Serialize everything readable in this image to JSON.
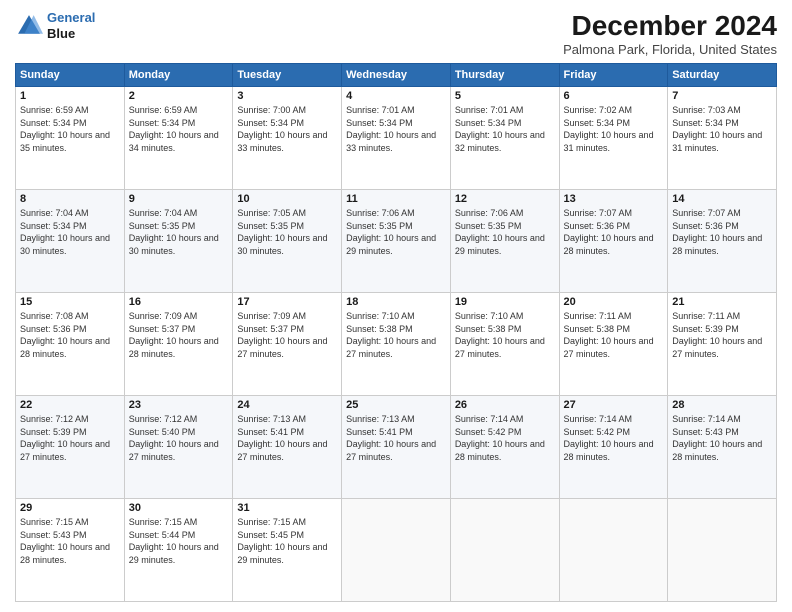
{
  "header": {
    "logo_line1": "General",
    "logo_line2": "Blue",
    "title": "December 2024",
    "subtitle": "Palmona Park, Florida, United States"
  },
  "calendar": {
    "weekdays": [
      "Sunday",
      "Monday",
      "Tuesday",
      "Wednesday",
      "Thursday",
      "Friday",
      "Saturday"
    ],
    "weeks": [
      [
        {
          "day": "1",
          "sunrise": "6:59 AM",
          "sunset": "5:34 PM",
          "daylight": "10 hours and 35 minutes."
        },
        {
          "day": "2",
          "sunrise": "6:59 AM",
          "sunset": "5:34 PM",
          "daylight": "10 hours and 34 minutes."
        },
        {
          "day": "3",
          "sunrise": "7:00 AM",
          "sunset": "5:34 PM",
          "daylight": "10 hours and 33 minutes."
        },
        {
          "day": "4",
          "sunrise": "7:01 AM",
          "sunset": "5:34 PM",
          "daylight": "10 hours and 33 minutes."
        },
        {
          "day": "5",
          "sunrise": "7:01 AM",
          "sunset": "5:34 PM",
          "daylight": "10 hours and 32 minutes."
        },
        {
          "day": "6",
          "sunrise": "7:02 AM",
          "sunset": "5:34 PM",
          "daylight": "10 hours and 31 minutes."
        },
        {
          "day": "7",
          "sunrise": "7:03 AM",
          "sunset": "5:34 PM",
          "daylight": "10 hours and 31 minutes."
        }
      ],
      [
        {
          "day": "8",
          "sunrise": "7:04 AM",
          "sunset": "5:34 PM",
          "daylight": "10 hours and 30 minutes."
        },
        {
          "day": "9",
          "sunrise": "7:04 AM",
          "sunset": "5:35 PM",
          "daylight": "10 hours and 30 minutes."
        },
        {
          "day": "10",
          "sunrise": "7:05 AM",
          "sunset": "5:35 PM",
          "daylight": "10 hours and 30 minutes."
        },
        {
          "day": "11",
          "sunrise": "7:06 AM",
          "sunset": "5:35 PM",
          "daylight": "10 hours and 29 minutes."
        },
        {
          "day": "12",
          "sunrise": "7:06 AM",
          "sunset": "5:35 PM",
          "daylight": "10 hours and 29 minutes."
        },
        {
          "day": "13",
          "sunrise": "7:07 AM",
          "sunset": "5:36 PM",
          "daylight": "10 hours and 28 minutes."
        },
        {
          "day": "14",
          "sunrise": "7:07 AM",
          "sunset": "5:36 PM",
          "daylight": "10 hours and 28 minutes."
        }
      ],
      [
        {
          "day": "15",
          "sunrise": "7:08 AM",
          "sunset": "5:36 PM",
          "daylight": "10 hours and 28 minutes."
        },
        {
          "day": "16",
          "sunrise": "7:09 AM",
          "sunset": "5:37 PM",
          "daylight": "10 hours and 28 minutes."
        },
        {
          "day": "17",
          "sunrise": "7:09 AM",
          "sunset": "5:37 PM",
          "daylight": "10 hours and 27 minutes."
        },
        {
          "day": "18",
          "sunrise": "7:10 AM",
          "sunset": "5:38 PM",
          "daylight": "10 hours and 27 minutes."
        },
        {
          "day": "19",
          "sunrise": "7:10 AM",
          "sunset": "5:38 PM",
          "daylight": "10 hours and 27 minutes."
        },
        {
          "day": "20",
          "sunrise": "7:11 AM",
          "sunset": "5:38 PM",
          "daylight": "10 hours and 27 minutes."
        },
        {
          "day": "21",
          "sunrise": "7:11 AM",
          "sunset": "5:39 PM",
          "daylight": "10 hours and 27 minutes."
        }
      ],
      [
        {
          "day": "22",
          "sunrise": "7:12 AM",
          "sunset": "5:39 PM",
          "daylight": "10 hours and 27 minutes."
        },
        {
          "day": "23",
          "sunrise": "7:12 AM",
          "sunset": "5:40 PM",
          "daylight": "10 hours and 27 minutes."
        },
        {
          "day": "24",
          "sunrise": "7:13 AM",
          "sunset": "5:41 PM",
          "daylight": "10 hours and 27 minutes."
        },
        {
          "day": "25",
          "sunrise": "7:13 AM",
          "sunset": "5:41 PM",
          "daylight": "10 hours and 27 minutes."
        },
        {
          "day": "26",
          "sunrise": "7:14 AM",
          "sunset": "5:42 PM",
          "daylight": "10 hours and 28 minutes."
        },
        {
          "day": "27",
          "sunrise": "7:14 AM",
          "sunset": "5:42 PM",
          "daylight": "10 hours and 28 minutes."
        },
        {
          "day": "28",
          "sunrise": "7:14 AM",
          "sunset": "5:43 PM",
          "daylight": "10 hours and 28 minutes."
        }
      ],
      [
        {
          "day": "29",
          "sunrise": "7:15 AM",
          "sunset": "5:43 PM",
          "daylight": "10 hours and 28 minutes."
        },
        {
          "day": "30",
          "sunrise": "7:15 AM",
          "sunset": "5:44 PM",
          "daylight": "10 hours and 29 minutes."
        },
        {
          "day": "31",
          "sunrise": "7:15 AM",
          "sunset": "5:45 PM",
          "daylight": "10 hours and 29 minutes."
        },
        null,
        null,
        null,
        null
      ]
    ]
  }
}
